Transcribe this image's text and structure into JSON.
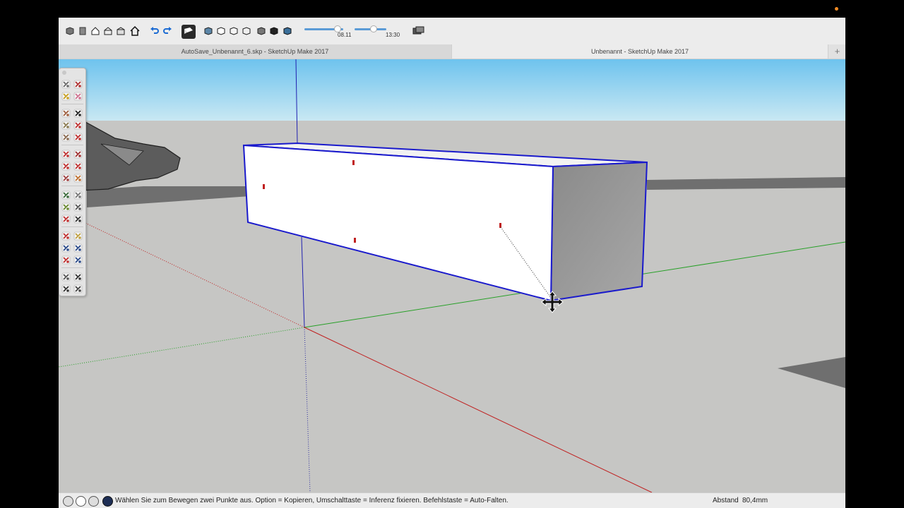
{
  "toolbar": {
    "icons": [
      "components-icon",
      "materials-icon",
      "house-icon",
      "house-2-icon",
      "house-3-icon",
      "home-icon",
      "undo-icon",
      "redo-icon"
    ],
    "style_button": "style-icon",
    "views": [
      "iso-view-icon",
      "top-view-icon",
      "front-view-icon",
      "right-view-icon",
      "back-view-icon",
      "left-view-icon",
      "bottom-view-icon"
    ],
    "shadow_date_label": "08.11",
    "shadow_time_label": "13:30",
    "shadow_date_fraction": 0.85,
    "shadow_time_fraction": 0.6
  },
  "tabs": [
    {
      "title": "AutoSave_Unbenannt_6.skp - SketchUp Make 2017"
    },
    {
      "title": "Unbenannt - SketchUp Make 2017"
    }
  ],
  "tab_add_label": "+",
  "palette": {
    "tools": [
      "select-icon",
      "make-component-icon",
      "paint-bucket-icon",
      "eraser-icon",
      "rectangle-icon",
      "line-icon",
      "circle-icon",
      "arc-icon",
      "polygon-icon",
      "freehand-icon",
      "move-icon",
      "push-pull-icon",
      "rotate-icon",
      "follow-me-icon",
      "scale-icon",
      "offset-icon",
      "tape-measure-icon",
      "dimension-icon",
      "protractor-icon",
      "text-icon",
      "axes-icon",
      "3d-text-icon",
      "orbit-icon",
      "pan-icon",
      "zoom-icon",
      "zoom-window-icon",
      "zoom-extents-icon",
      "previous-view-icon",
      "position-camera-icon",
      "walk-icon",
      "look-around-icon",
      "section-plane-icon"
    ]
  },
  "status": {
    "message": "Wählen Sie zum Bewegen zwei Punkte aus. Option = Kopieren, Umschalttaste = Inferenz fixieren. Befehlstaste = Auto-Falten.",
    "measure_label": "Abstand",
    "measure_value": "80,4mm",
    "icons": [
      "geo-location-icon",
      "credits-icon",
      "user-icon",
      "instructor-icon"
    ]
  },
  "colors": {
    "sky": "#8fd3ef",
    "ground": "#c8c8c6",
    "selection": "#1a1acc",
    "axis_red": "#c02020",
    "axis_green": "#28a028",
    "axis_blue": "#2020b0",
    "accent_orange": "#f08a24"
  }
}
